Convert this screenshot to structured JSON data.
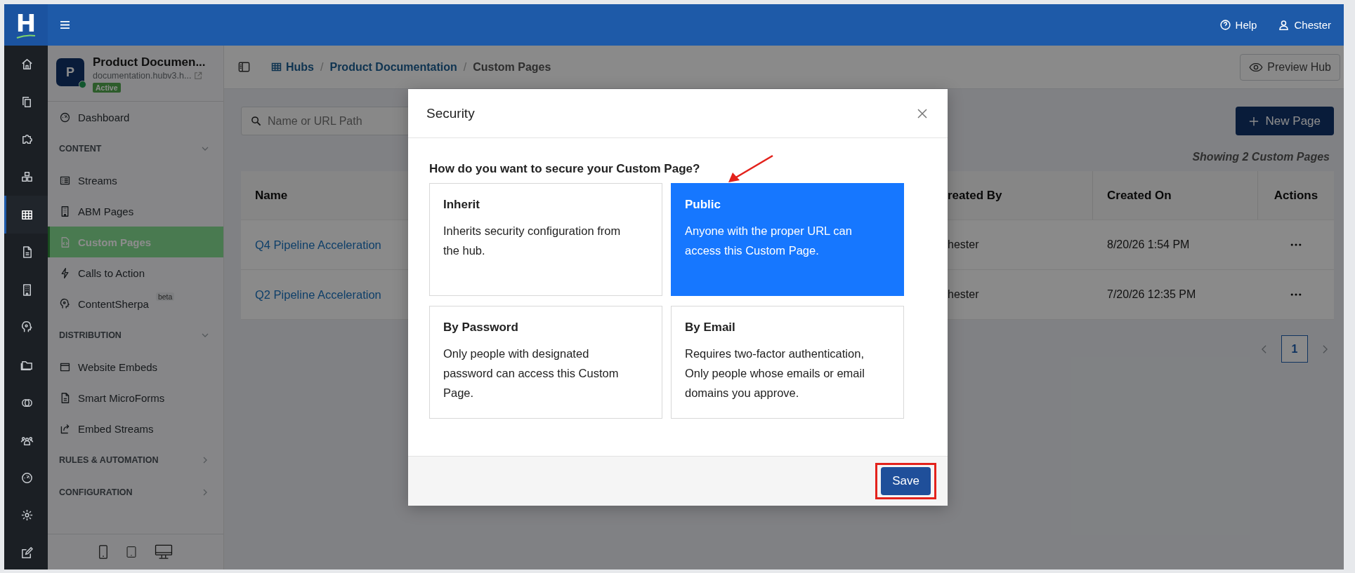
{
  "logo": {
    "letter": "H"
  },
  "topbar": {
    "help": "Help",
    "user": "Chester"
  },
  "rail": [
    {
      "kind": "home",
      "selected": false
    },
    {
      "kind": "copy",
      "selected": false
    },
    {
      "kind": "puzzle",
      "selected": false
    },
    {
      "kind": "cubes",
      "selected": false
    },
    {
      "kind": "grid",
      "selected": true
    },
    {
      "kind": "file",
      "selected": false
    },
    {
      "kind": "building",
      "selected": false
    },
    {
      "kind": "head",
      "selected": false
    },
    {
      "kind": "folder",
      "selected": false
    },
    {
      "kind": "circles",
      "selected": false
    },
    {
      "kind": "users",
      "selected": false
    },
    {
      "kind": "gauge",
      "selected": false
    },
    {
      "kind": "gear",
      "selected": false
    },
    {
      "kind": "edit",
      "selected": false
    }
  ],
  "hub": {
    "avatar": "P",
    "name": "Product Documen...",
    "url": "documentation.hubv3.h...",
    "status": "Active",
    "online": true
  },
  "sidebar": {
    "items": [
      {
        "kind": "item",
        "label": "Dashboard",
        "selected": false
      },
      {
        "kind": "section",
        "label": "CONTENT",
        "expanded": true
      },
      {
        "kind": "item",
        "label": "Streams",
        "selected": false
      },
      {
        "kind": "item",
        "label": "ABM Pages",
        "selected": false
      },
      {
        "kind": "item",
        "label": "Custom Pages",
        "selected": true
      },
      {
        "kind": "item",
        "label": "Calls to Action",
        "selected": false
      },
      {
        "kind": "item",
        "label": "ContentSherpa",
        "badge": "beta",
        "selected": false
      },
      {
        "kind": "section",
        "label": "DISTRIBUTION",
        "expanded": true
      },
      {
        "kind": "item",
        "label": "Website Embeds",
        "selected": false
      },
      {
        "kind": "item",
        "label": "Smart MicroForms",
        "selected": false
      },
      {
        "kind": "item",
        "label": "Embed Streams",
        "selected": false
      },
      {
        "kind": "section",
        "label": "RULES & AUTOMATION",
        "expanded": false
      },
      {
        "kind": "section",
        "label": "CONFIGURATION",
        "expanded": false
      }
    ]
  },
  "breadcrumb": [
    {
      "kind": "link",
      "label": "Hubs"
    },
    {
      "kind": "separator",
      "label": "/"
    },
    {
      "kind": "link",
      "label": "Product Documentation"
    },
    {
      "kind": "separator",
      "label": "/"
    },
    {
      "kind": "current",
      "label": "Custom Pages"
    }
  ],
  "preview_button": "Preview Hub",
  "search": {
    "placeholder": "Name or URL Path"
  },
  "new_page_button": "New Page",
  "count_text": "Showing 2 Custom Pages",
  "table": {
    "columns": [
      "Name",
      "reated By",
      "Created On",
      "Actions"
    ],
    "rows": [
      {
        "name": "Q4 Pipeline Acceleration",
        "created_by": "hester",
        "created_on": "8/20/26 1:54 PM"
      },
      {
        "name": "Q2 Pipeline Acceleration",
        "created_by": "hester",
        "created_on": "7/20/26 12:35 PM"
      }
    ]
  },
  "pagination": {
    "pages": [
      {
        "label": "1",
        "selected": true
      }
    ]
  },
  "modal": {
    "title": "Security",
    "question": "How do you want to secure your Custom Page?",
    "options": [
      {
        "title": "Inherit",
        "description": "Inherits security configuration from the hub.",
        "selected": false
      },
      {
        "title": "Public",
        "description": "Anyone with the proper URL can access this Custom Page.",
        "selected": true
      },
      {
        "title": "By Password",
        "description": "Only people with designated password can access this Custom Page.",
        "selected": false
      },
      {
        "title": "By Email",
        "description": "Requires two-factor authentication, Only people whose emails or email domains you approve.",
        "selected": false
      }
    ],
    "save_button": "Save"
  }
}
